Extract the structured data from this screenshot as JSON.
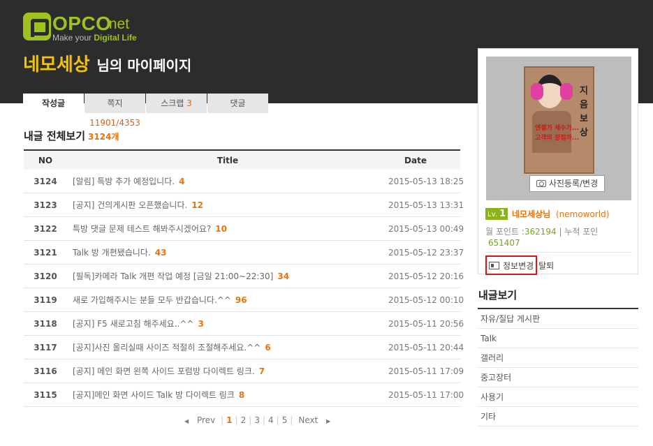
{
  "logo": {
    "letter": "P",
    "word": "OPCO",
    "net": ".net",
    "tagline_prefix": "Make your ",
    "tagline_bold": "Digital Life"
  },
  "header": {
    "name": "네모세상",
    "suffix": "님의 마이페이지"
  },
  "tabs": [
    {
      "label": "작성글",
      "count": "",
      "active": true
    },
    {
      "label": "쪽지",
      "count": "11901/4353",
      "active": false
    },
    {
      "label": "스크랩",
      "count": "3",
      "active": false
    },
    {
      "label": "댓글",
      "count": "",
      "active": false
    }
  ],
  "section": {
    "title": "내글 전체보기",
    "count": "3124개"
  },
  "table": {
    "headers": {
      "no": "NO",
      "title": "Title",
      "date": "Date"
    },
    "rows": [
      {
        "no": "3124",
        "title": "[알림] 특방 추가 예정입니다.",
        "replies": "4",
        "date": "2015-05-13 18:25"
      },
      {
        "no": "3123",
        "title": "[공지] 건의게시판 오픈했습니다.",
        "replies": "12",
        "date": "2015-05-13 13:31"
      },
      {
        "no": "3122",
        "title": "특방 댓글 문제 테스트 해봐주시겠어요?",
        "replies": "10",
        "date": "2015-05-13 00:49"
      },
      {
        "no": "3121",
        "title": "Talk 방 개편됐습니다.",
        "replies": "43",
        "date": "2015-05-12 23:37"
      },
      {
        "no": "3120",
        "title": "[필독]카메라 Talk 개편 작업 예정 [금일 21:00~22:30]",
        "replies": "34",
        "date": "2015-05-12 20:16"
      },
      {
        "no": "3119",
        "title": "새로 가입해주시는 분들 모두 반갑습니다.^^",
        "replies": "96",
        "date": "2015-05-12 00:10"
      },
      {
        "no": "3118",
        "title": "[공지] F5 새로고침 해주세요..^^",
        "replies": "3",
        "date": "2015-05-11 20:56"
      },
      {
        "no": "3117",
        "title": "[공지]사진 올리실때 사이즈 적절히 조절해주세요.^^",
        "replies": "6",
        "date": "2015-05-11 20:44"
      },
      {
        "no": "3116",
        "title": "[공지] 메인 화면 왼쪽 사이드 포럼방 다이렉트 링크.",
        "replies": "7",
        "date": "2015-05-11 17:09"
      },
      {
        "no": "3115",
        "title": "[공지]메인 화면 사이드 Talk 방 다이렉트 링크",
        "replies": "8",
        "date": "2015-05-11 17:00"
      }
    ]
  },
  "pagination": {
    "prev": "Prev",
    "next": "Next",
    "pages": [
      "1",
      "2",
      "3",
      "4",
      "5"
    ],
    "current": "1"
  },
  "profile": {
    "poster_vertical_text": "지음보상",
    "poster_red_line1": "엔젤가 세수가...",
    "poster_red_line2": "고객의 장점까...",
    "photo_button": "사진등록/변경",
    "level_prefix": "Lv.",
    "level": "1",
    "nickname": "네모세상님",
    "user_id": "(nemoworld)",
    "points_label1": "월 포인트 :",
    "points_value1": "362194",
    "points_sep": "| 누적 포인",
    "points_value2": "651407",
    "info_button": "정보변경",
    "leave_link": "탈퇴"
  },
  "mylist": {
    "title": "내글보기",
    "items": [
      "자유/질답 게시판",
      "Talk",
      "갤러리",
      "중고장터",
      "사용기",
      "기타"
    ]
  },
  "colors": {
    "accent_orange": "#e8730c",
    "brand_green": "#9ec31c",
    "title_yellow": "#f5c400",
    "highlight_red": "#d81818"
  }
}
